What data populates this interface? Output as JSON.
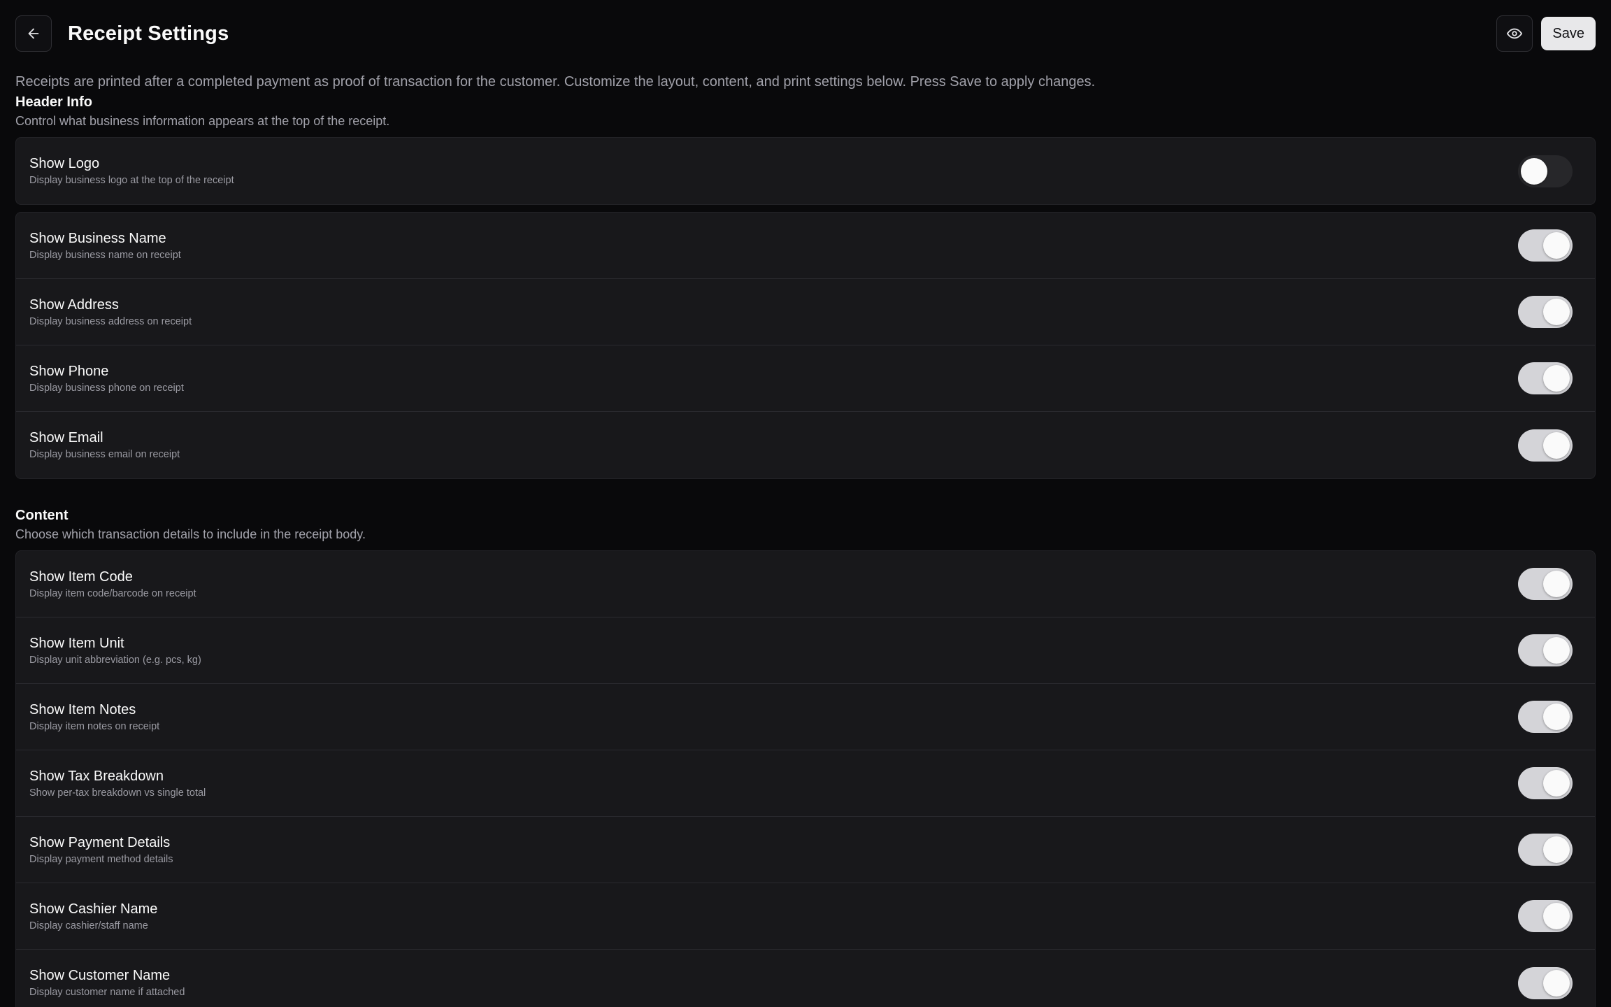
{
  "header": {
    "title": "Receipt Settings",
    "save_label": "Save"
  },
  "intro": "Receipts are printed after a completed payment as proof of transaction for the customer. Customize the layout, content, and print settings below. Press Save to apply changes.",
  "header_info": {
    "title": "Header Info",
    "description": "Control what business information appears at the top of the receipt.",
    "logo": {
      "label": "Show Logo",
      "description": "Display business logo at the top of the receipt",
      "enabled": false
    },
    "items": [
      {
        "label": "Show Business Name",
        "description": "Display business name on receipt",
        "enabled": true
      },
      {
        "label": "Show Address",
        "description": "Display business address on receipt",
        "enabled": true
      },
      {
        "label": "Show Phone",
        "description": "Display business phone on receipt",
        "enabled": true
      },
      {
        "label": "Show Email",
        "description": "Display business email on receipt",
        "enabled": true
      }
    ]
  },
  "content": {
    "title": "Content",
    "description": "Choose which transaction details to include in the receipt body.",
    "items": [
      {
        "label": "Show Item Code",
        "description": "Display item code/barcode on receipt",
        "enabled": true
      },
      {
        "label": "Show Item Unit",
        "description": "Display unit abbreviation (e.g. pcs, kg)",
        "enabled": true
      },
      {
        "label": "Show Item Notes",
        "description": "Display item notes on receipt",
        "enabled": true
      },
      {
        "label": "Show Tax Breakdown",
        "description": "Show per-tax breakdown vs single total",
        "enabled": true
      },
      {
        "label": "Show Payment Details",
        "description": "Display payment method details",
        "enabled": true
      },
      {
        "label": "Show Cashier Name",
        "description": "Display cashier/staff name",
        "enabled": true
      },
      {
        "label": "Show Customer Name",
        "description": "Display customer name if attached",
        "enabled": true
      }
    ]
  },
  "icons": {
    "back": "arrow-left-icon",
    "preview": "eye-icon"
  }
}
